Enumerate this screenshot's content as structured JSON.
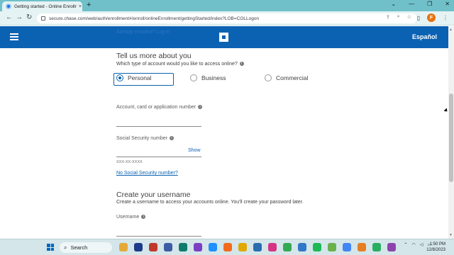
{
  "browser": {
    "tab_title": "Getting started - Online Enrollm",
    "tab_close": "×",
    "new_tab": "+",
    "url": "secure.chase.com/web/auth/enrollment#/enroll/onlineEnrollment/gettingStarted/index?LOB=COLLogon",
    "back": "←",
    "forward": "→",
    "reload": "↻",
    "window_controls": [
      "⌄",
      "—",
      "❐",
      "✕"
    ]
  },
  "header": {
    "language_link": "Español",
    "ghost_text": "Already enrolled? Log in"
  },
  "form": {
    "section_title": "Tell us more about you",
    "account_type_question": "Which type of account would you like to access online?",
    "account_types": [
      {
        "label": "Personal",
        "selected": true
      },
      {
        "label": "Business",
        "selected": false
      },
      {
        "label": "Commercial",
        "selected": false
      }
    ],
    "account_number_label": "Account, card or application number",
    "ssn_label": "Social Security number",
    "ssn_show": "Show",
    "ssn_hint": "XXX-XX-XXXX",
    "no_ssn_link": "No Social Security number?",
    "username_title": "Create your username",
    "username_desc": "Create a username to access your accounts online. You'll create your password later.",
    "username_label": "Username"
  },
  "taskbar": {
    "search_label": "Search",
    "time": "1:50 PM",
    "date": "12/8/2023",
    "icon_colors": [
      "#e5a93a",
      "#1e3a8a",
      "#c0392b",
      "#3b5ba5",
      "#0f7b6c",
      "#7b3fc4",
      "#1e90ff",
      "#f26b1d",
      "#e0a800",
      "#2b6cb0",
      "#d63384",
      "#34a853",
      "#3178c6",
      "#1db954",
      "#6ab04c",
      "#4285f4",
      "#e67e22",
      "#27ae60",
      "#8e44ad"
    ]
  },
  "colors": {
    "brand": "#0b62b3",
    "tab_strip": "#6fc0c9"
  }
}
